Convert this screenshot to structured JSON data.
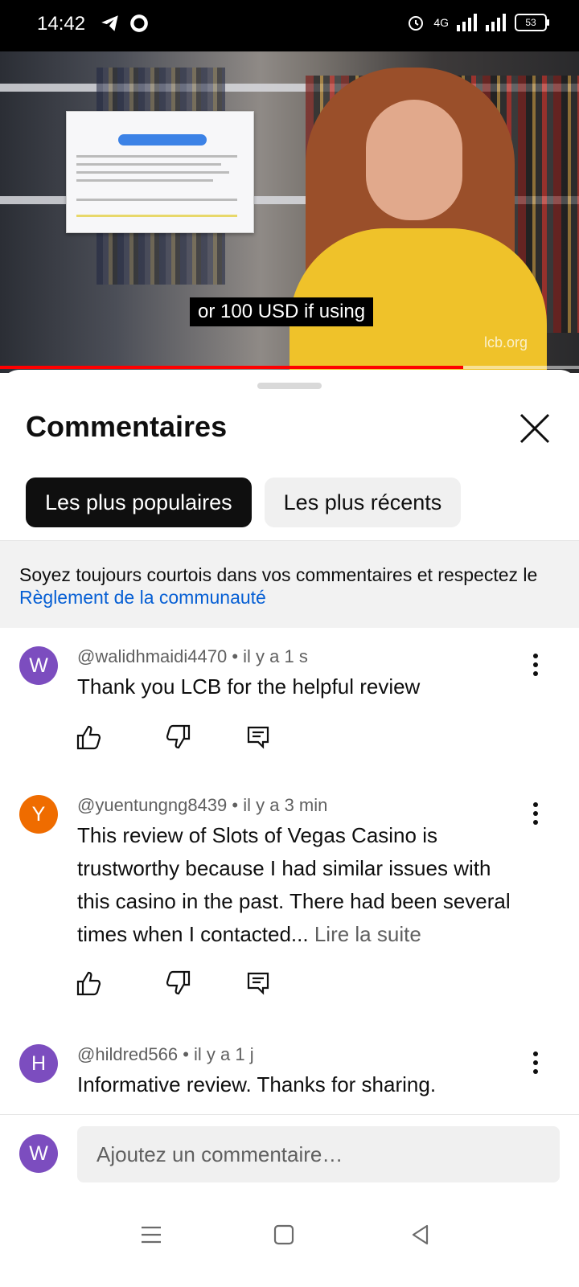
{
  "status_bar": {
    "time": "14:42",
    "network": "4G",
    "battery": "53"
  },
  "video": {
    "caption": "or 100 USD if using",
    "watermark": "lcb.org",
    "progress_fraction": 0.8
  },
  "comments_sheet": {
    "title": "Commentaires",
    "close_icon": "close-icon",
    "filters": [
      {
        "label": "Les plus populaires",
        "active": true
      },
      {
        "label": "Les plus récents",
        "active": false
      }
    ],
    "notice": {
      "text": "Soyez toujours courtois dans vos commentaires et respectez le ",
      "link": "Règlement de la communauté"
    },
    "comments": [
      {
        "avatar_letter": "W",
        "avatar_color": "#7c4dbf",
        "author": "@walidhmaidi4470",
        "time": "il y a 1 s",
        "text": "Thank you LCB for the helpful review",
        "read_more": ""
      },
      {
        "avatar_letter": "Y",
        "avatar_color": "#ef6c00",
        "author": "@yuentungng8439",
        "time": "il y a 3 min",
        "text": "This review of Slots of Vegas Casino is trustworthy because I had similar issues with this casino in the past. There had been several times when I contacted...",
        "read_more": "Lire la suite"
      },
      {
        "avatar_letter": "H",
        "avatar_color": "#7c4dbf",
        "author": "@hildred566",
        "time": "il y a 1 j",
        "text": "Informative review. Thanks for sharing.",
        "read_more": ""
      }
    ],
    "composer": {
      "avatar_letter": "W",
      "placeholder": "Ajoutez un commentaire…"
    }
  },
  "icons": {
    "like": "thumb-up-icon",
    "dislike": "thumb-down-icon",
    "reply": "reply-icon",
    "more": "more-vert-icon"
  },
  "colors": {
    "accent_link": "#065fd4",
    "progress": "#ff0000"
  }
}
